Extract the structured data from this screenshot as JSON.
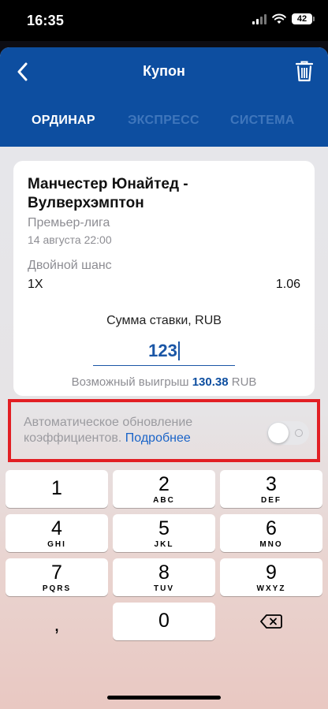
{
  "status_bar": {
    "time": "16:35",
    "battery": "42"
  },
  "header": {
    "title": "Купон",
    "tabs": [
      {
        "label": "ОРДИНАР",
        "active": true
      },
      {
        "label": "ЭКСПРЕСС",
        "active": false
      },
      {
        "label": "СИСТЕМА",
        "active": false
      }
    ]
  },
  "bet": {
    "match": "Манчестер Юнайтед - Вулверхэмптон",
    "league": "Премьер-лига",
    "date": "14 августа 22:00",
    "market": "Двойной шанс",
    "outcome": "1X",
    "odds": "1.06",
    "stake_label": "Сумма ставки, RUB",
    "stake_value": "123",
    "winnings_prefix": "Возможный выигрыш",
    "winnings_amount": "130.38",
    "winnings_currency": "RUB"
  },
  "auto_update": {
    "text": "Автоматическое обновление коэффициентов.",
    "link": "Подробнее",
    "enabled": false
  },
  "keypad": {
    "keys": [
      {
        "digit": "1",
        "letters": ""
      },
      {
        "digit": "2",
        "letters": "ABC"
      },
      {
        "digit": "3",
        "letters": "DEF"
      },
      {
        "digit": "4",
        "letters": "GHI"
      },
      {
        "digit": "5",
        "letters": "JKL"
      },
      {
        "digit": "6",
        "letters": "MNO"
      },
      {
        "digit": "7",
        "letters": "PQRS"
      },
      {
        "digit": "8",
        "letters": "TUV"
      },
      {
        "digit": "9",
        "letters": "WXYZ"
      }
    ],
    "comma": ",",
    "zero": "0"
  },
  "colors": {
    "brand": "#0d4ea0",
    "accent": "#1a56a6",
    "highlight": "#e21f24"
  }
}
